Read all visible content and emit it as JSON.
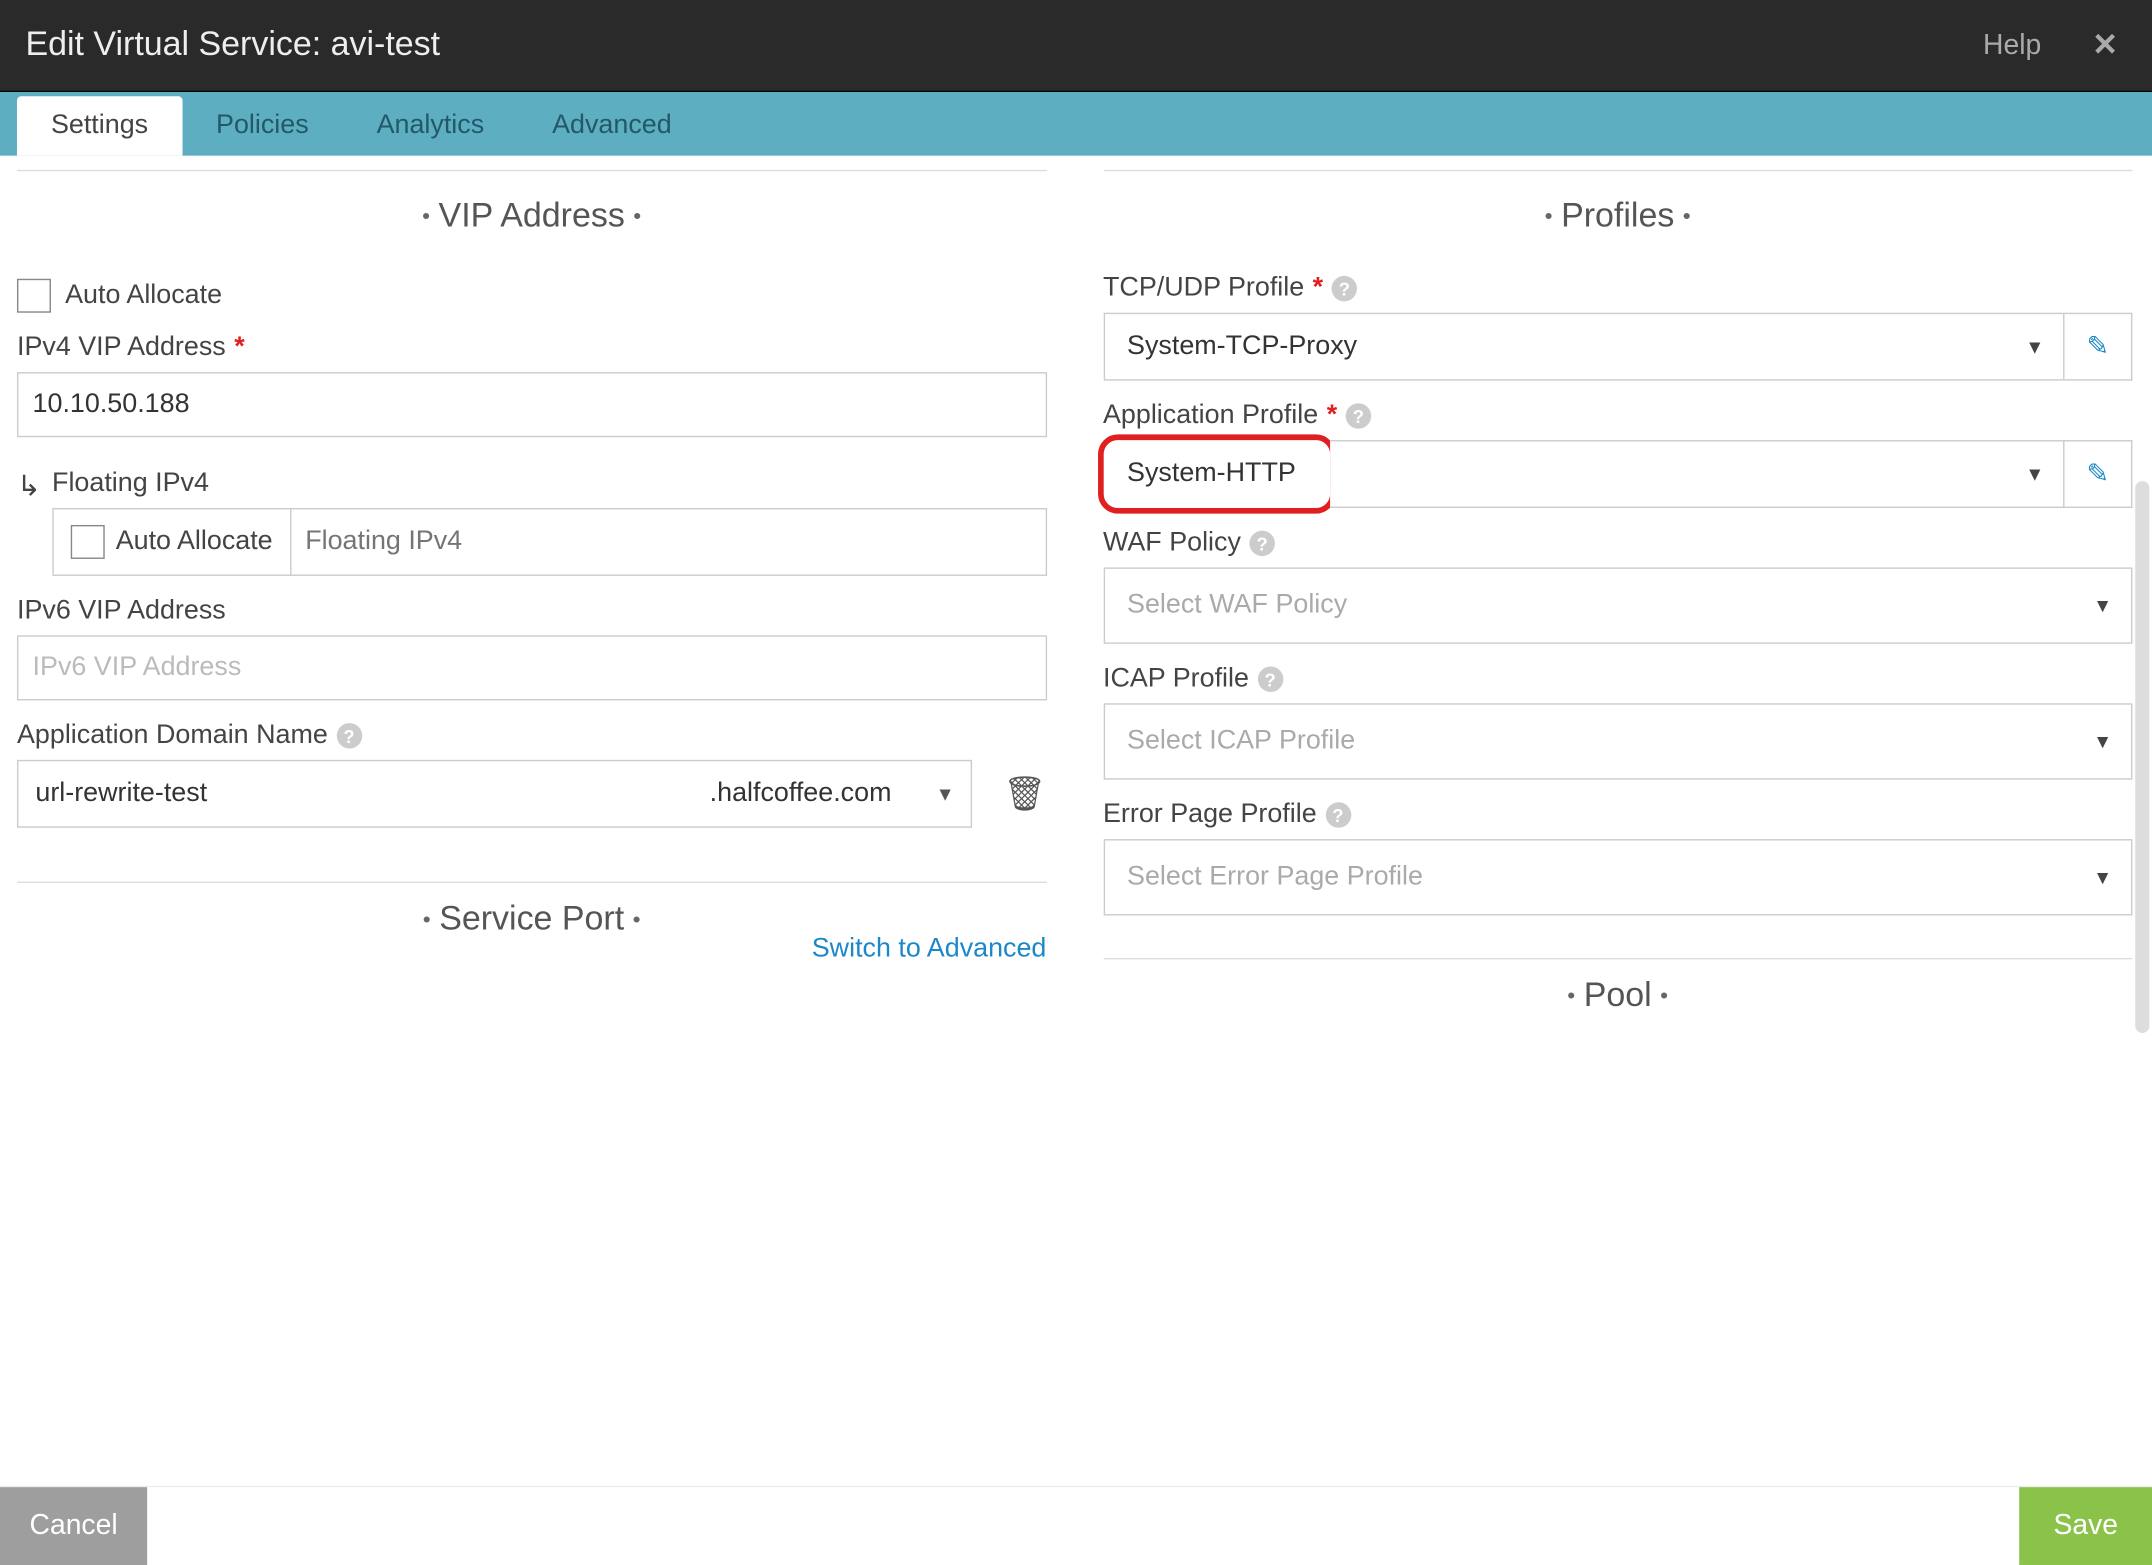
{
  "header": {
    "title": "Edit Virtual Service: avi-test",
    "help": "Help"
  },
  "tabs": {
    "active": "Settings",
    "items": [
      "Settings",
      "Policies",
      "Analytics",
      "Advanced"
    ]
  },
  "left": {
    "section_vip": "VIP Address",
    "auto_allocate": "Auto Allocate",
    "ipv4_label": "IPv4 VIP Address",
    "ipv4_value": "10.10.50.188",
    "floating_label": "Floating IPv4",
    "floating_auto": "Auto Allocate",
    "floating_placeholder": "Floating IPv4",
    "ipv6_label": "IPv6 VIP Address",
    "ipv6_placeholder": "IPv6 VIP Address",
    "domain_label": "Application Domain Name",
    "domain_value": "url-rewrite-test",
    "domain_suffix": ".halfcoffee.com",
    "section_port": "Service Port",
    "switch_link": "Switch to Advanced"
  },
  "right": {
    "section_profiles": "Profiles",
    "tcp_label": "TCP/UDP Profile",
    "tcp_value": "System-TCP-Proxy",
    "app_label": "Application Profile",
    "app_value": "System-HTTP",
    "waf_label": "WAF Policy",
    "waf_placeholder": "Select WAF Policy",
    "icap_label": "ICAP Profile",
    "icap_placeholder": "Select ICAP Profile",
    "err_label": "Error Page Profile",
    "err_placeholder": "Select Error Page Profile",
    "section_pool": "Pool"
  },
  "footer": {
    "cancel": "Cancel",
    "save": "Save"
  }
}
